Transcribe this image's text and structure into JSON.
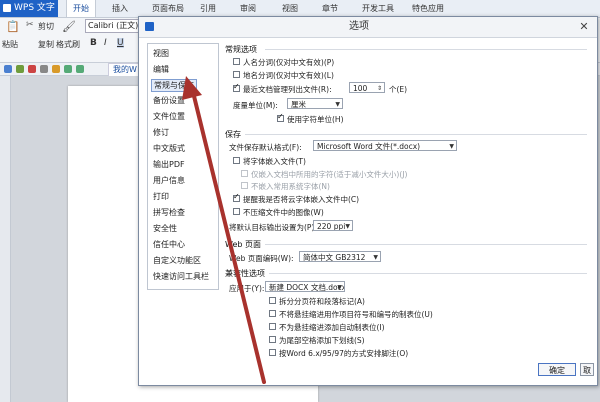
{
  "app": {
    "title": "WPS 文字",
    "menu": [
      "开始",
      "插入",
      "页面布局",
      "引用",
      "审阅",
      "视图",
      "章节",
      "开发工具",
      "特色应用"
    ],
    "active_menu": "开始",
    "toolbar": {
      "cut": "剪切",
      "paste": "粘贴",
      "copy": "复制",
      "format_painter": "格式刷",
      "font": "Calibri (正文)",
      "bold": "B",
      "italic": "I",
      "underline": "U"
    },
    "doc_tab": "我的W"
  },
  "dialog": {
    "title": "选项",
    "nav_items": [
      "视图",
      "编辑",
      "常规与保存",
      "备份设置",
      "文件位置",
      "修订",
      "中文版式",
      "输出PDF",
      "用户信息",
      "打印",
      "拼写检查",
      "安全性",
      "信任中心",
      "自定义功能区",
      "快速访问工具栏"
    ],
    "selected_nav": "常规与保存",
    "general": {
      "heading": "常规选项",
      "opt1": "人名分词(仅对中文有效)(P)",
      "opt2": "地名分词(仅对中文有效)(L)",
      "recent_label": "最近文档管理列出文件(R):",
      "recent_value": "100",
      "recent_unit": "个(E)",
      "unit_label": "度量单位(M):",
      "unit_value": "厘米",
      "char_unit": "使用字符单位(H)"
    },
    "save": {
      "heading": "保存",
      "format_label": "文件保存默认格式(F):",
      "format_value": "Microsoft Word 文件(*.docx)",
      "embed_fonts": "将字体嵌入文件(T)",
      "embed_used": "仅嵌入文档中所用的字符(适于减小文件大小)(J)",
      "embed_common": "不嵌入常用系统字体(N)",
      "cloud_font": "提醒我是否将云字体嵌入文件中(C)",
      "no_compress": "不压缩文件中的图像(W)",
      "res_label": "将默认目标输出设置为(P):",
      "res_value": "220 ppi"
    },
    "web": {
      "heading": "Web 页面",
      "enc_label": "Web 页面编码(W):",
      "enc_value": "简体中文 GB2312"
    },
    "compat": {
      "heading": "兼容性选项",
      "apply_label": "应用于(Y):",
      "apply_value": "新建 DOCX 文档.docx",
      "o1": "拆分分页符和段落标记(A)",
      "o2": "不将悬挂缩进用作项目符号和编号的制表位(U)",
      "o3": "不为悬挂缩进添加自动制表位(I)",
      "o4": "为尾部空格添加下划线(S)",
      "o5": "按Word 6.x/95/97的方式安排脚注(O)"
    },
    "buttons": {
      "ok": "确定",
      "cancel": "取消"
    }
  },
  "colors": {
    "accent": "#1f62c6",
    "arrow": "#a8322d"
  }
}
